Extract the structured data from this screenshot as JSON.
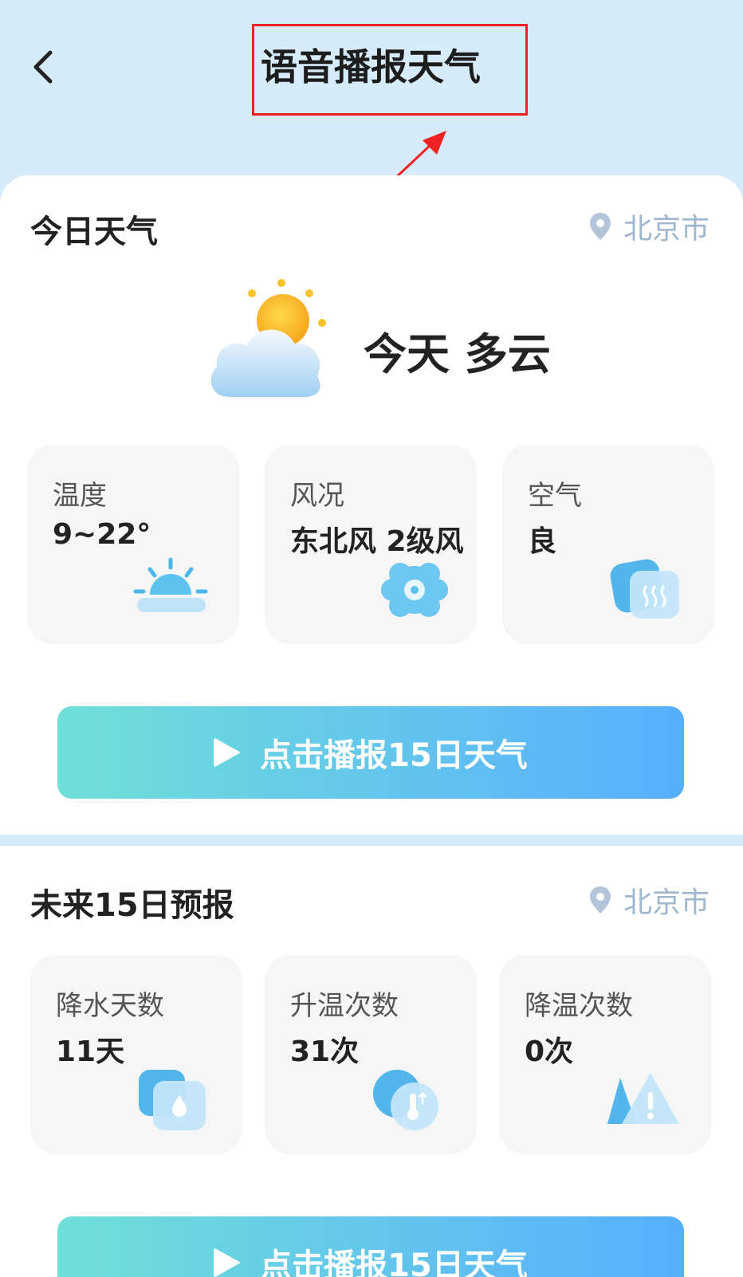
{
  "header": {
    "title": "语音播报天气"
  },
  "today": {
    "section_title": "今日天气",
    "location": "北京市",
    "condition": "今天 多云",
    "tiles": [
      {
        "label": "温度",
        "value": "9~22°",
        "icon": "sunrise-icon"
      },
      {
        "label": "风况",
        "value": "东北风 2级风",
        "icon": "wind-icon"
      },
      {
        "label": "空气",
        "value": "良",
        "icon": "air-icon"
      }
    ],
    "play_label": "点击播报15日天气"
  },
  "forecast": {
    "section_title": "未来15日预报",
    "location": "北京市",
    "tiles": [
      {
        "label": "降水天数",
        "value": "11天",
        "icon": "raindrop-icon"
      },
      {
        "label": "升温次数",
        "value": "31次",
        "icon": "thermometer-up-icon"
      },
      {
        "label": "降温次数",
        "value": "0次",
        "icon": "warning-icon"
      }
    ],
    "play_label": "点击播报15日天气"
  },
  "colors": {
    "header_bg": "#d6ecfb",
    "accent_start": "#6fe0d8",
    "accent_end": "#58aefe",
    "highlight": "#ee2222",
    "location": "#9fb6cf"
  }
}
